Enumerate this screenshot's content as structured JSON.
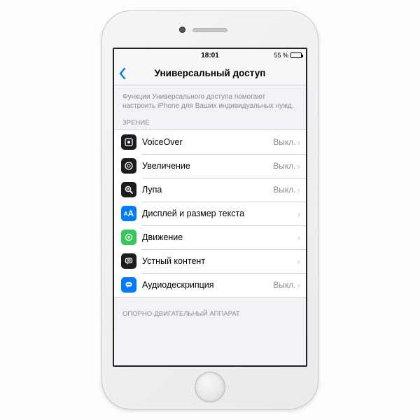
{
  "statusbar": {
    "time": "18:01",
    "battery_text": "55 %"
  },
  "navbar": {
    "title": "Универсальный доступ"
  },
  "description": "Функции Универсального доступа помогают настроить iPhone для Ваших индивидуальных нужд.",
  "sections": {
    "vision": {
      "header": "ЗРЕНИЕ",
      "items": [
        {
          "label": "VoiceOver",
          "value": "Выкл."
        },
        {
          "label": "Увеличение",
          "value": "Выкл."
        },
        {
          "label": "Лупа",
          "value": "Выкл."
        },
        {
          "label": "Дисплей и размер текста",
          "value": ""
        },
        {
          "label": "Движение",
          "value": ""
        },
        {
          "label": "Устный контент",
          "value": ""
        },
        {
          "label": "Аудиодескрипция",
          "value": "Выкл."
        }
      ]
    },
    "motor": {
      "header": "ОПОРНО-ДВИГАТЕЛЬНЫЙ АППАРАТ"
    }
  }
}
